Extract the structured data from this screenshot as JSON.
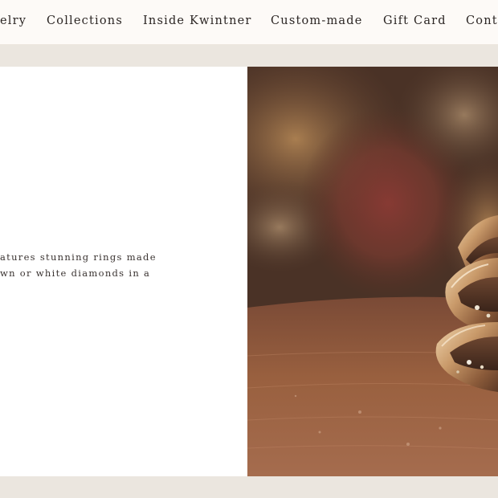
{
  "nav": {
    "items": [
      {
        "label": "elry"
      },
      {
        "label": "Collections"
      },
      {
        "label": "Inside Kwintner"
      },
      {
        "label": "Custom-made"
      },
      {
        "label": "Gift Card"
      },
      {
        "label": "Cont"
      }
    ]
  },
  "intro": {
    "line1": "atures stunning rings made",
    "line2": "wn or white diamonds in a"
  },
  "colors": {
    "nav_bg": "#fdfaf7",
    "page_bg": "#ebe6df",
    "text": "#2b2523"
  }
}
